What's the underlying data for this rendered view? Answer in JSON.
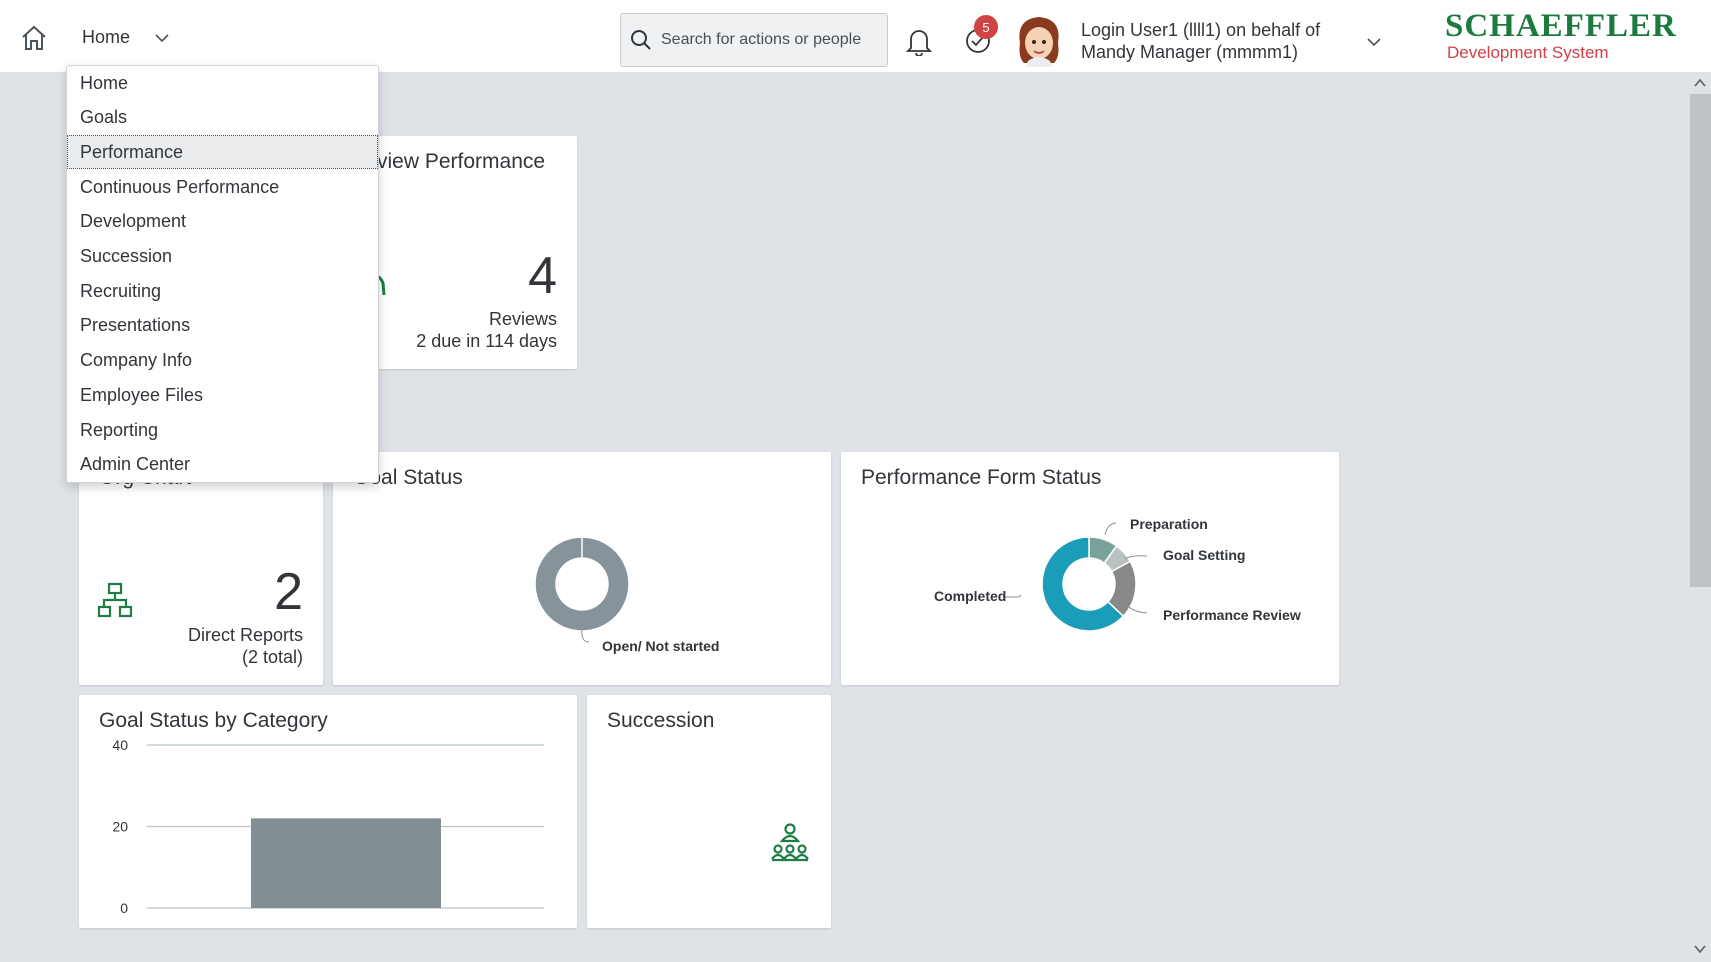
{
  "header": {
    "home_menu_label": "Home",
    "search_placeholder": "Search for actions or people",
    "notification_badge": "5",
    "user_line1": "Login User1 (llll1) on behalf of",
    "user_line2": "Mandy Manager (mmmm1)",
    "logo_brand": "SCHAEFFLER",
    "logo_sub": "Development System"
  },
  "menu": {
    "selected": "Performance",
    "items": [
      "Home",
      "Goals",
      "Performance",
      "Continuous Performance",
      "Development",
      "Succession",
      "Recruiting",
      "Presentations",
      "Company Info",
      "Employee Files",
      "Reporting",
      "Admin Center"
    ]
  },
  "tiles": {
    "review": {
      "title": "view Performance",
      "count": "4",
      "label": "Reviews",
      "due": "2 due in 114 days"
    },
    "org": {
      "title": "Org Chart",
      "count": "2",
      "label": "Direct Reports",
      "total": "(2 total)"
    },
    "goal_status": {
      "title": "Goal Status",
      "legend": "Open/ Not started"
    },
    "perf_form": {
      "title": "Performance Form Status",
      "labels": {
        "preparation": "Preparation",
        "goal_setting": "Goal Setting",
        "performance_review": "Performance Review",
        "completed": "Completed"
      }
    },
    "goal_cat": {
      "title": "Goal Status by Category"
    },
    "succession": {
      "title": "Succession"
    }
  },
  "chart_data": [
    {
      "type": "pie",
      "title": "Goal Status",
      "categories": [
        "Open/ Not started"
      ],
      "values": [
        100
      ]
    },
    {
      "type": "pie",
      "title": "Performance Form Status",
      "categories": [
        "Preparation",
        "Goal Setting",
        "Performance Review",
        "Completed"
      ],
      "values": [
        10,
        7,
        20,
        63
      ]
    },
    {
      "type": "bar",
      "title": "Goal Status by Category",
      "categories": [
        ""
      ],
      "values": [
        22
      ],
      "ylim": [
        0,
        40
      ],
      "yticks": [
        0,
        20,
        40
      ]
    }
  ],
  "colors": {
    "green_icon": "#1e7d44",
    "donut_gray": "#87939a",
    "completed_teal": "#1b9db9",
    "preparation": "#79a39a",
    "goal_setting": "#b9c2c0",
    "perf_review": "#888888",
    "bar_gray": "#838e94"
  }
}
